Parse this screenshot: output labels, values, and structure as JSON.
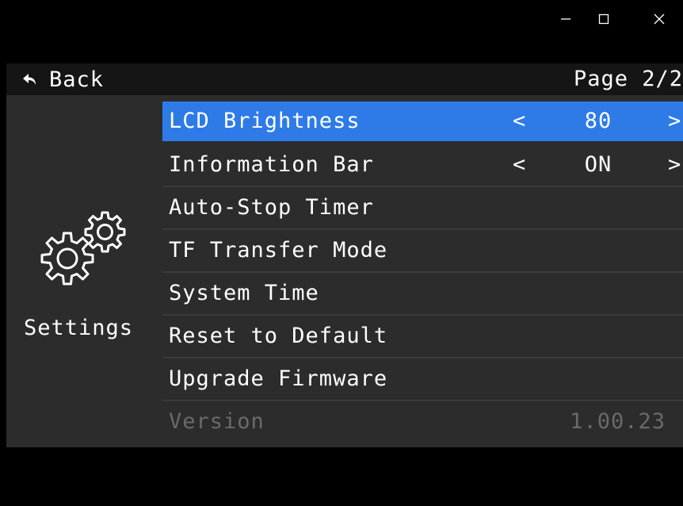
{
  "window": {
    "minimize_icon": "minimize-icon",
    "maximize_icon": "maximize-icon",
    "close_icon": "close-icon"
  },
  "header": {
    "back_icon": "back-arrow-icon",
    "back_label": "Back",
    "page_label": "Page 2/2"
  },
  "sidebar": {
    "icon": "gears-icon",
    "label": "Settings"
  },
  "menu": {
    "items": [
      {
        "label": "LCD Brightness",
        "left_arrow": "<",
        "value": "80",
        "right_arrow": ">",
        "selected": true
      },
      {
        "label": "Information Bar",
        "left_arrow": "<",
        "value": "ON",
        "right_arrow": ">"
      },
      {
        "label": "Auto-Stop Timer"
      },
      {
        "label": "TF Transfer Mode"
      },
      {
        "label": "System Time"
      },
      {
        "label": "Reset to Default"
      },
      {
        "label": "Upgrade Firmware"
      },
      {
        "label": "Version",
        "value": "1.00.23",
        "disabled": true
      }
    ]
  },
  "colors": {
    "accent": "#2e7be8",
    "panel": "#2c2c2c",
    "header": "#151515",
    "disabled_text": "#6a6a6a"
  }
}
